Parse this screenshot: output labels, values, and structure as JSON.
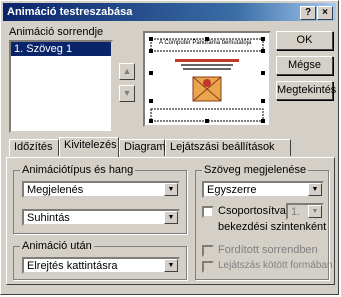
{
  "window": {
    "title": "Animáció testreszabása",
    "help_btn": "?",
    "close_btn": "×"
  },
  "order": {
    "label": "Animáció sorrendje",
    "items": [
      "1. Szöveg 1"
    ]
  },
  "preview": {
    "slide_title": "A Computer Panoráma bemutatója",
    "move_up": "▲",
    "move_down": "▼"
  },
  "buttons": {
    "ok": "OK",
    "cancel": "Mégse",
    "preview": "Megtekintés"
  },
  "tabs": [
    "Időzítés",
    "Kivitelezés",
    "Diagram",
    "Lejátszási beállítások"
  ],
  "effects": {
    "group_label": "Animációtípus és hang",
    "effect": "Megjelenés",
    "sound": "Suhintás"
  },
  "after": {
    "group_label": "Animáció után",
    "value": "Elrejtés kattintásra"
  },
  "text": {
    "group_label": "Szöveg megjelenése",
    "mode": "Egyszerre",
    "grouped_label": "Csoportosítva",
    "grouped_level": "1.",
    "grouped_suffix": "bekezdési szintenként",
    "reverse": "Fordított sorrendben",
    "in_shape": "Lejátszás kötött formában"
  },
  "icons": {
    "dropdown": "▼"
  }
}
